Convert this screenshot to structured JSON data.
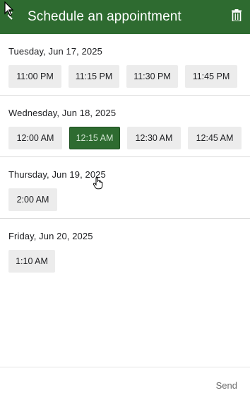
{
  "header": {
    "title": "Schedule an appointment",
    "back_icon": "chevron-left-icon",
    "trash_icon": "trash-icon",
    "color": "#2e6b30"
  },
  "days": [
    {
      "label": "Tuesday, Jun 17, 2025",
      "slots": [
        "11:00 PM",
        "11:15 PM",
        "11:30 PM",
        "11:45 PM"
      ]
    },
    {
      "label": "Wednesday, Jun 18, 2025",
      "slots": [
        "12:00 AM",
        "12:15 AM",
        "12:30 AM",
        "12:45 AM"
      ],
      "selected_slot": "12:15 AM"
    },
    {
      "label": "Thursday, Jun 19, 2025",
      "slots": [
        "2:00 AM"
      ]
    },
    {
      "label": "Friday, Jun 20, 2025",
      "slots": [
        "1:10 AM"
      ]
    }
  ],
  "footer": {
    "send_label": "Send"
  }
}
